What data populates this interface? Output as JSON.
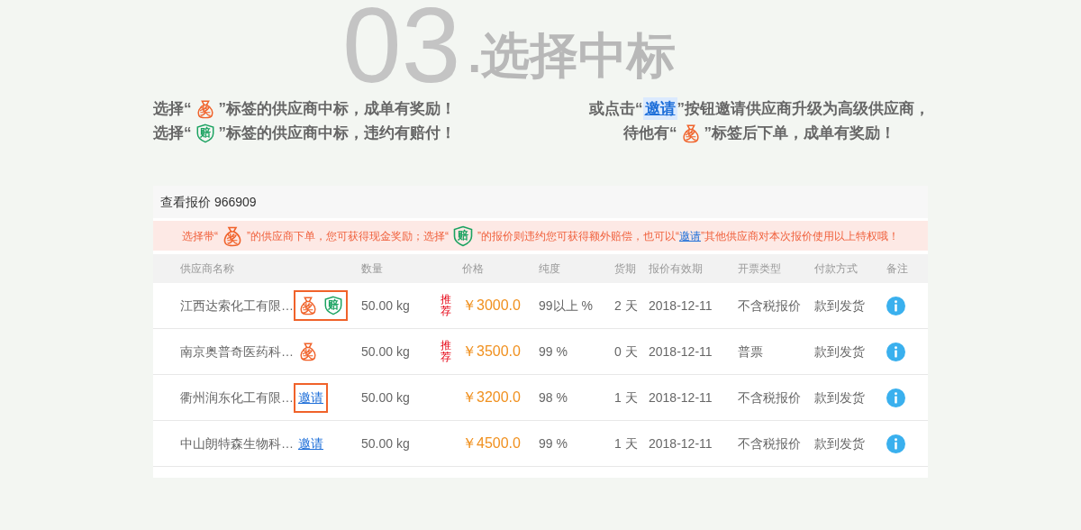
{
  "heading": {
    "number": "03",
    "title": ".选择中标"
  },
  "notes_left": [
    [
      {
        "kind": "text",
        "text": "选择“"
      },
      {
        "kind": "bag",
        "text": "奖"
      },
      {
        "kind": "text",
        "text": "”标签的供应商中标，成单有奖励！"
      }
    ],
    [
      {
        "kind": "text",
        "text": "选择“"
      },
      {
        "kind": "shield",
        "text": "赔"
      },
      {
        "kind": "text",
        "text": "”标签的供应商中标，违约有赔付！"
      }
    ]
  ],
  "notes_right": [
    [
      {
        "kind": "text",
        "text": "或点击“"
      },
      {
        "kind": "link",
        "text": "邀请"
      },
      {
        "kind": "text",
        "text": "”按钮邀请供应商升级为高级供应商，"
      }
    ],
    [
      {
        "kind": "text",
        "text": "待他有“"
      },
      {
        "kind": "bag",
        "text": "奖"
      },
      {
        "kind": "text",
        "text": "”标签后下单，成单有奖励！"
      }
    ]
  ],
  "card_title": "查看报价 966909",
  "alert": [
    {
      "kind": "text",
      "text": "选择带“"
    },
    {
      "kind": "bag",
      "text": "奖"
    },
    {
      "kind": "text",
      "text": "”的供应商下单，您可获得现金奖励；选择“"
    },
    {
      "kind": "shield",
      "text": "赔"
    },
    {
      "kind": "text",
      "text": "”的报价则违约您可获得额外赔偿，也可以“"
    },
    {
      "kind": "link",
      "text": "邀请"
    },
    {
      "kind": "text",
      "text": "”其他供应商对本次报价使用以上特权哦！"
    }
  ],
  "columns": [
    "供应商名称",
    "数量",
    "价格",
    "纯度",
    "货期",
    "报价有效期",
    "开票类型",
    "付款方式",
    "备注"
  ],
  "rows": [
    {
      "supplier": "江西达索化工有限…",
      "highlighted": true,
      "tags": [
        {
          "kind": "bag",
          "text": "奖"
        },
        {
          "kind": "shield",
          "text": "赔"
        }
      ],
      "quantity": "50.00 kg",
      "recommend": "推荐",
      "price": "￥3000.0",
      "purity": "99以上 %",
      "lead_time": "2 天",
      "valid_until": "2018-12-11",
      "invoice": "不含税报价",
      "payment": "款到发货"
    },
    {
      "supplier": "南京奥普奇医药科…",
      "highlighted": false,
      "tags": [
        {
          "kind": "bag",
          "text": "奖"
        }
      ],
      "quantity": "50.00 kg",
      "recommend": "推荐",
      "price": "￥3500.0",
      "purity": "99 %",
      "lead_time": "0 天",
      "valid_until": "2018-12-11",
      "invoice": "普票",
      "payment": "款到发货"
    },
    {
      "supplier": "衢州润东化工有限…",
      "highlighted": true,
      "tags": [
        {
          "kind": "link",
          "text": "邀请"
        }
      ],
      "quantity": "50.00 kg",
      "price": "￥3200.0",
      "purity": "98 %",
      "lead_time": "1 天",
      "valid_until": "2018-12-11",
      "invoice": "不含税报价",
      "payment": "款到发货"
    },
    {
      "supplier": "中山朗特森生物科…",
      "highlighted": false,
      "tags": [
        {
          "kind": "link",
          "text": "邀请"
        }
      ],
      "quantity": "50.00 kg",
      "price": "￥4500.0",
      "purity": "99 %",
      "lead_time": "1 天",
      "valid_until": "2018-12-11",
      "invoice": "不含税报价",
      "payment": "款到发货"
    }
  ]
}
